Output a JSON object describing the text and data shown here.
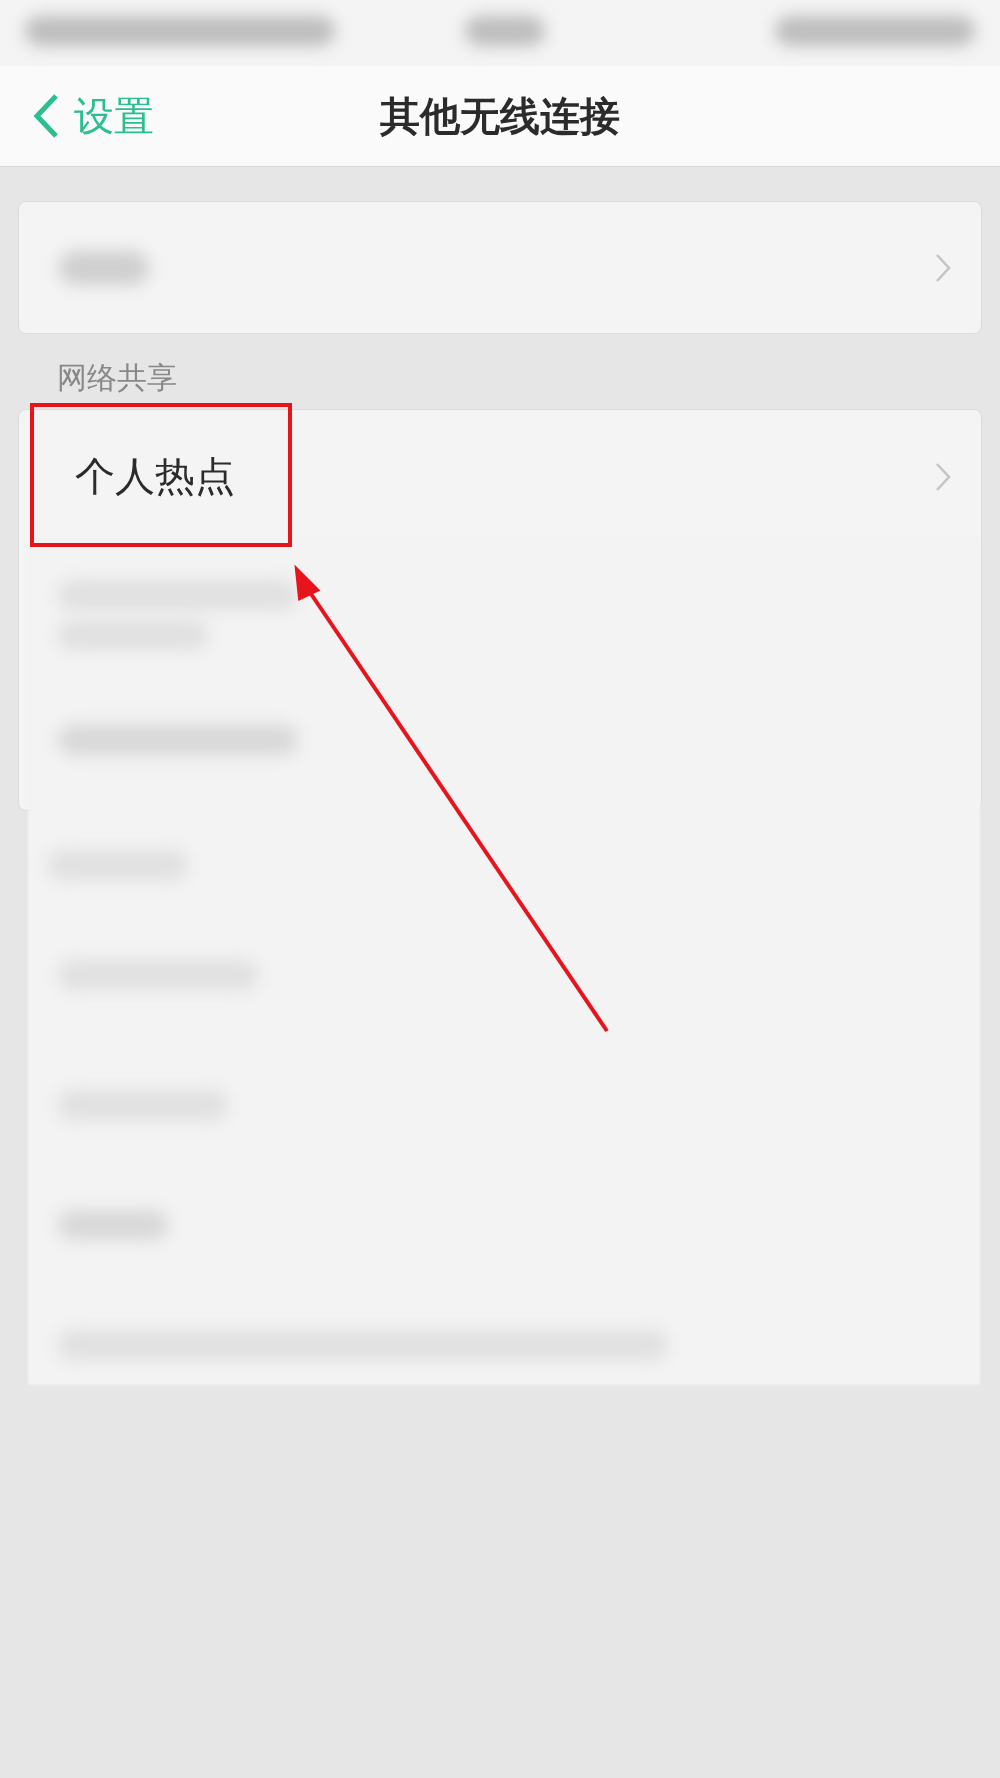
{
  "nav": {
    "back_label": "设置",
    "title": "其他无线连接"
  },
  "section_header": "网络共享",
  "hotspot_row": {
    "label": "个人热点"
  }
}
